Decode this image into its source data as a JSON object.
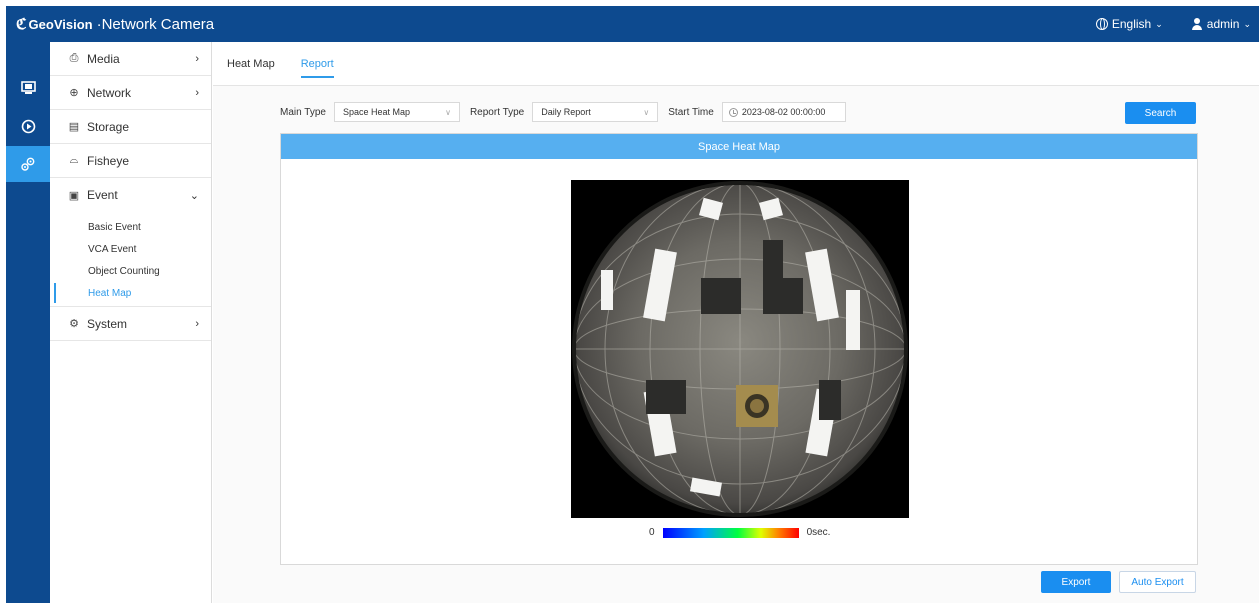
{
  "header": {
    "brand": "GeoVision",
    "title": "·Network Camera",
    "language": "English",
    "user": "admin"
  },
  "rail": {
    "items": [
      {
        "icon": "monitor-icon"
      },
      {
        "icon": "playback-icon"
      },
      {
        "icon": "settings-icon"
      }
    ],
    "active_index": 2
  },
  "sidebar": {
    "items": [
      {
        "label": "Media",
        "icon": "media-icon"
      },
      {
        "label": "Network",
        "icon": "network-icon"
      },
      {
        "label": "Storage",
        "icon": "storage-icon"
      },
      {
        "label": "Fisheye",
        "icon": "fisheye-icon"
      },
      {
        "label": "Event",
        "icon": "event-icon"
      },
      {
        "label": "System",
        "icon": "system-icon"
      }
    ],
    "event_sub": [
      "Basic Event",
      "VCA Event",
      "Object Counting",
      "Heat Map"
    ]
  },
  "tabs": [
    "Heat Map",
    "Report"
  ],
  "filters": {
    "main_type_label": "Main Type",
    "main_type_value": "Space Heat Map",
    "report_type_label": "Report Type",
    "report_type_value": "Daily Report",
    "start_time_label": "Start Time",
    "start_time_value": "2023-08-02 00:00:00",
    "search_label": "Search"
  },
  "panel": {
    "title": "Space Heat Map",
    "legend_min": "0",
    "legend_max": "0sec."
  },
  "actions": {
    "export_label": "Export",
    "auto_export_label": "Auto Export"
  },
  "colors": {
    "header_bg": "#0d4a8f",
    "accent": "#2f9be9",
    "button": "#1a8ef0",
    "panel_head": "#56aff0"
  }
}
